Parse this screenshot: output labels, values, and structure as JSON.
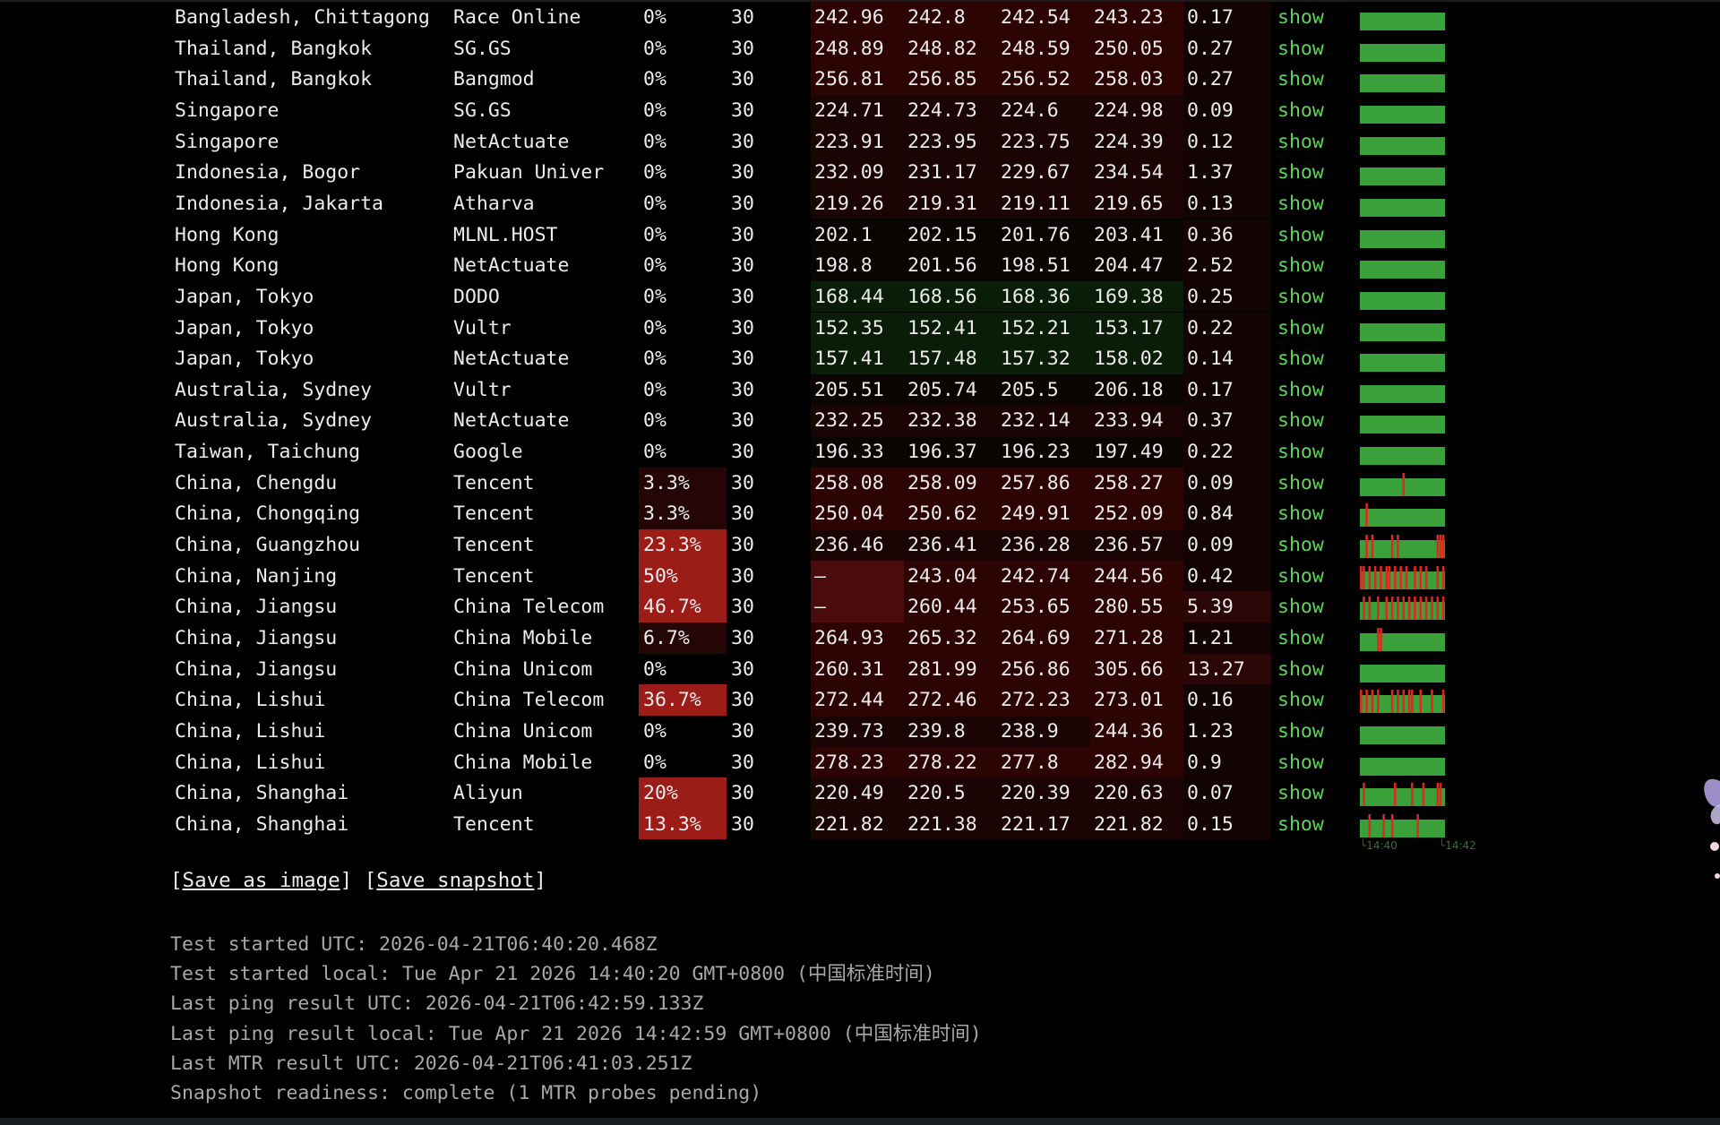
{
  "table": {
    "rows": [
      {
        "location": "Bangladesh, Chittagong",
        "provider": "Race Online",
        "loss": "0%",
        "sent": "30",
        "last": "242.96",
        "avg": "242.8",
        "best": "242.54",
        "worst": "243.23",
        "stdev": "0.17",
        "mtr": "show",
        "loss_bins": []
      },
      {
        "location": "Thailand, Bangkok",
        "provider": "SG.GS",
        "loss": "0%",
        "sent": "30",
        "last": "248.89",
        "avg": "248.82",
        "best": "248.59",
        "worst": "250.05",
        "stdev": "0.27",
        "mtr": "show",
        "loss_bins": []
      },
      {
        "location": "Thailand, Bangkok",
        "provider": "Bangmod",
        "loss": "0%",
        "sent": "30",
        "last": "256.81",
        "avg": "256.85",
        "best": "256.52",
        "worst": "258.03",
        "stdev": "0.27",
        "mtr": "show",
        "loss_bins": []
      },
      {
        "location": "Singapore",
        "provider": "SG.GS",
        "loss": "0%",
        "sent": "30",
        "last": "224.71",
        "avg": "224.73",
        "best": "224.6",
        "worst": "224.98",
        "stdev": "0.09",
        "mtr": "show",
        "loss_bins": []
      },
      {
        "location": "Singapore",
        "provider": "NetActuate",
        "loss": "0%",
        "sent": "30",
        "last": "223.91",
        "avg": "223.95",
        "best": "223.75",
        "worst": "224.39",
        "stdev": "0.12",
        "mtr": "show",
        "loss_bins": []
      },
      {
        "location": "Indonesia, Bogor",
        "provider": "Pakuan Univer",
        "loss": "0%",
        "sent": "30",
        "last": "232.09",
        "avg": "231.17",
        "best": "229.67",
        "worst": "234.54",
        "stdev": "1.37",
        "mtr": "show",
        "loss_bins": []
      },
      {
        "location": "Indonesia, Jakarta",
        "provider": "Atharva",
        "loss": "0%",
        "sent": "30",
        "last": "219.26",
        "avg": "219.31",
        "best": "219.11",
        "worst": "219.65",
        "stdev": "0.13",
        "mtr": "show",
        "loss_bins": []
      },
      {
        "location": "Hong Kong",
        "provider": "MLNL.HOST",
        "loss": "0%",
        "sent": "30",
        "last": "202.1",
        "avg": "202.15",
        "best": "201.76",
        "worst": "203.41",
        "stdev": "0.36",
        "mtr": "show",
        "loss_bins": []
      },
      {
        "location": "Hong Kong",
        "provider": "NetActuate",
        "loss": "0%",
        "sent": "30",
        "last": "198.8",
        "avg": "201.56",
        "best": "198.51",
        "worst": "204.47",
        "stdev": "2.52",
        "mtr": "show",
        "loss_bins": []
      },
      {
        "location": "Japan, Tokyo",
        "provider": "DODO",
        "loss": "0%",
        "sent": "30",
        "last": "168.44",
        "avg": "168.56",
        "best": "168.36",
        "worst": "169.38",
        "stdev": "0.25",
        "mtr": "show",
        "loss_bins": []
      },
      {
        "location": "Japan, Tokyo",
        "provider": "Vultr",
        "loss": "0%",
        "sent": "30",
        "last": "152.35",
        "avg": "152.41",
        "best": "152.21",
        "worst": "153.17",
        "stdev": "0.22",
        "mtr": "show",
        "loss_bins": []
      },
      {
        "location": "Japan, Tokyo",
        "provider": "NetActuate",
        "loss": "0%",
        "sent": "30",
        "last": "157.41",
        "avg": "157.48",
        "best": "157.32",
        "worst": "158.02",
        "stdev": "0.14",
        "mtr": "show",
        "loss_bins": []
      },
      {
        "location": "Australia, Sydney",
        "provider": "Vultr",
        "loss": "0%",
        "sent": "30",
        "last": "205.51",
        "avg": "205.74",
        "best": "205.5",
        "worst": "206.18",
        "stdev": "0.17",
        "mtr": "show",
        "loss_bins": []
      },
      {
        "location": "Australia, Sydney",
        "provider": "NetActuate",
        "loss": "0%",
        "sent": "30",
        "last": "232.25",
        "avg": "232.38",
        "best": "232.14",
        "worst": "233.94",
        "stdev": "0.37",
        "mtr": "show",
        "loss_bins": []
      },
      {
        "location": "Taiwan, Taichung",
        "provider": "Google",
        "loss": "0%",
        "sent": "30",
        "last": "196.33",
        "avg": "196.37",
        "best": "196.23",
        "worst": "197.49",
        "stdev": "0.22",
        "mtr": "show",
        "loss_bins": []
      },
      {
        "location": "China, Chengdu",
        "provider": "Tencent",
        "loss": "3.3%",
        "sent": "30",
        "last": "258.08",
        "avg": "258.09",
        "best": "257.86",
        "worst": "258.27",
        "stdev": "0.09",
        "mtr": "show",
        "loss_bins": [
          15
        ]
      },
      {
        "location": "China, Chongqing",
        "provider": "Tencent",
        "loss": "3.3%",
        "sent": "30",
        "last": "250.04",
        "avg": "250.62",
        "best": "249.91",
        "worst": "252.09",
        "stdev": "0.84",
        "mtr": "show",
        "loss_bins": [
          2
        ]
      },
      {
        "location": "China, Guangzhou",
        "provider": "Tencent",
        "loss": "23.3%",
        "sent": "30",
        "last": "236.46",
        "avg": "236.41",
        "best": "236.28",
        "worst": "236.57",
        "stdev": "0.09",
        "mtr": "show",
        "loss_bins": [
          2,
          4,
          11,
          13,
          27,
          28,
          29
        ]
      },
      {
        "location": "China, Nanjing",
        "provider": "Tencent",
        "loss": "50%",
        "sent": "30",
        "last": "–",
        "avg": "243.04",
        "best": "242.74",
        "worst": "244.56",
        "stdev": "0.42",
        "mtr": "show",
        "loss_bins": [
          0,
          1,
          3,
          5,
          7,
          9,
          10,
          12,
          14,
          16,
          19,
          21,
          23,
          27,
          29
        ]
      },
      {
        "location": "China, Jiangsu",
        "provider": "China Telecom",
        "loss": "46.7%",
        "sent": "30",
        "last": "–",
        "avg": "260.44",
        "best": "253.65",
        "worst": "280.55",
        "stdev": "5.39",
        "mtr": "show",
        "loss_bins": [
          1,
          3,
          6,
          9,
          11,
          13,
          15,
          17,
          19,
          21,
          23,
          25,
          27,
          29
        ]
      },
      {
        "location": "China, Jiangsu",
        "provider": "China Mobile",
        "loss": "6.7%",
        "sent": "30",
        "last": "264.93",
        "avg": "265.32",
        "best": "264.69",
        "worst": "271.28",
        "stdev": "1.21",
        "mtr": "show",
        "loss_bins": [
          6,
          7
        ]
      },
      {
        "location": "China, Jiangsu",
        "provider": "China Unicom",
        "loss": "0%",
        "sent": "30",
        "last": "260.31",
        "avg": "281.99",
        "best": "256.86",
        "worst": "305.66",
        "stdev": "13.27",
        "mtr": "show",
        "loss_bins": []
      },
      {
        "location": "China, Lishui",
        "provider": "China Telecom",
        "loss": "36.7%",
        "sent": "30",
        "last": "272.44",
        "avg": "272.46",
        "best": "272.23",
        "worst": "273.01",
        "stdev": "0.16",
        "mtr": "show",
        "loss_bins": [
          0,
          2,
          4,
          6,
          11,
          13,
          15,
          17,
          18,
          21,
          25,
          29
        ]
      },
      {
        "location": "China, Lishui",
        "provider": "China Unicom",
        "loss": "0%",
        "sent": "30",
        "last": "239.73",
        "avg": "239.8",
        "best": "238.9",
        "worst": "244.36",
        "stdev": "1.23",
        "mtr": "show",
        "loss_bins": []
      },
      {
        "location": "China, Lishui",
        "provider": "China Mobile",
        "loss": "0%",
        "sent": "30",
        "last": "278.23",
        "avg": "278.22",
        "best": "277.8",
        "worst": "282.94",
        "stdev": "0.9",
        "mtr": "show",
        "loss_bins": []
      },
      {
        "location": "China, Shanghai",
        "provider": "Aliyun",
        "loss": "20%",
        "sent": "30",
        "last": "220.49",
        "avg": "220.5",
        "best": "220.39",
        "worst": "220.63",
        "stdev": "0.07",
        "mtr": "show",
        "loss_bins": [
          1,
          12,
          18,
          22,
          27,
          28
        ]
      },
      {
        "location": "China, Shanghai",
        "provider": "Tencent",
        "loss": "13.3%",
        "sent": "30",
        "last": "221.82",
        "avg": "221.38",
        "best": "221.17",
        "worst": "221.82",
        "stdev": "0.15",
        "mtr": "show",
        "loss_bins": [
          3,
          8,
          11,
          20
        ]
      }
    ]
  },
  "graph_times": {
    "start": "14:40",
    "end": "14:42"
  },
  "actions": {
    "save_image": "Save as image",
    "save_snapshot": "Save snapshot"
  },
  "info": {
    "started_utc": "Test started UTC: 2026-04-21T06:40:20.468Z",
    "started_local": "Test started local: Tue Apr 21 2026 14:40:20 GMT+0800 (中国标准时间)",
    "last_ping_utc": "Last ping result UTC: 2026-04-21T06:42:59.133Z",
    "last_ping_local": "Last ping result local: Tue Apr 21 2026 14:42:59 GMT+0800 (中国标准时间)",
    "last_mtr_utc": "Last MTR result UTC: 2026-04-21T06:41:03.251Z",
    "snapshot": "Snapshot readiness: complete (1 MTR probes pending)"
  },
  "colors": {
    "background": "#000000",
    "text": "#ececec",
    "link_green": "#5fd35a",
    "graph_ok": "#3aa13a",
    "graph_loss": "#e0281f",
    "loss_high": "#9c1d18",
    "latency_green_tint": "#0a200a",
    "latency_red_tint": "#2a0707"
  },
  "decorations": {
    "corner_icon": "butterfly-icon"
  }
}
